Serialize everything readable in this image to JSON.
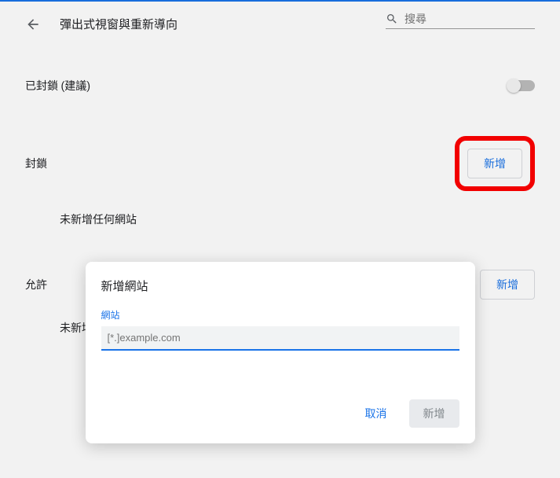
{
  "header": {
    "title": "彈出式視窗與重新導向",
    "search_placeholder": "搜尋"
  },
  "blocked_section": {
    "label": "已封鎖 (建議)"
  },
  "block_list": {
    "label": "封鎖",
    "add_button": "新增",
    "empty_text": "未新增任何網站"
  },
  "allow_list": {
    "label": "允許",
    "add_button": "新增",
    "empty_text": "未新增任何網站"
  },
  "dialog": {
    "title": "新增網站",
    "field_label": "網站",
    "input_placeholder": "[*.]example.com",
    "cancel": "取消",
    "confirm": "新增"
  }
}
